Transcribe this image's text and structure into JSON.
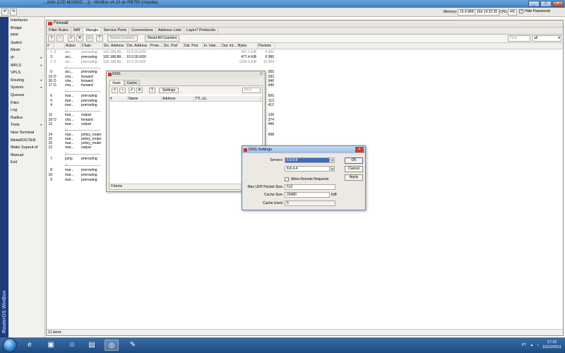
{
  "window": {
    "title": "... (Info (Lt'D MUNDO ...)) - WinBox v4.10 on RB750 (mipsbe)",
    "buttons": [
      "_",
      "□",
      "×"
    ]
  },
  "toolbar": {
    "undo": "↶",
    "redo": "↷",
    "memory_label": "Memory:",
    "memory_value": "15.4 MiB",
    "uptime_value": "16d 14:32:35",
    "cpu_label": "CPU:",
    "cpu_value": "4%",
    "hide_passwords_label": "Hide Passwords",
    "hide_passwords_checked": "✓"
  },
  "brand_vertical": "RouterOS WinBox",
  "sidebar": {
    "items": [
      {
        "label": "Interfaces",
        "arrow": ""
      },
      {
        "label": "Bridge",
        "arrow": ""
      },
      {
        "label": "PPP",
        "arrow": ""
      },
      {
        "label": "Switch",
        "arrow": ""
      },
      {
        "label": "Mesh",
        "arrow": ""
      },
      {
        "label": "IP",
        "arrow": "▸"
      },
      {
        "label": "MPLS",
        "arrow": "▸"
      },
      {
        "label": "VPLS",
        "arrow": ""
      },
      {
        "label": "Routing",
        "arrow": "▸"
      },
      {
        "label": "System",
        "arrow": "▸"
      },
      {
        "label": "Queues",
        "arrow": ""
      },
      {
        "label": "Files",
        "arrow": ""
      },
      {
        "label": "Log",
        "arrow": ""
      },
      {
        "label": "Radius",
        "arrow": ""
      },
      {
        "label": "Tools",
        "arrow": "▸"
      },
      {
        "label": "New Terminal",
        "arrow": ""
      },
      {
        "label": "MetaROUTER",
        "arrow": ""
      },
      {
        "label": "Make Supout.rif",
        "arrow": ""
      },
      {
        "label": "Manual",
        "arrow": ""
      },
      {
        "label": "Exit",
        "arrow": ""
      }
    ]
  },
  "firewall": {
    "title": "Firewall",
    "tabs": [
      "Filter Rules",
      "NAT",
      "Mangle",
      "Service Ports",
      "Connections",
      "Address Lists",
      "Layer7 Protocols"
    ],
    "active_tab": "Mangle",
    "toolbar": {
      "add": "+",
      "remove": "−",
      "enable": "✓",
      "disable": "✕",
      "comment": "▭",
      "filter": "⊤",
      "reset_counters": "Reset Counters",
      "reset_all_counters": "Reset All Counters",
      "find_placeholder": "Find",
      "select_value": "all",
      "select_arrow": "▾"
    },
    "columns": [
      "#",
      "",
      "Action",
      "Chain",
      "Src. Address",
      "Dst. Address",
      "Proto...",
      "Src. Port",
      "Dst. Port",
      "In. Inter...",
      "Out. Int...",
      "Bytes",
      "Packets"
    ],
    "rows": [
      {
        "num": "1",
        "flag": "X",
        "action": "acc...",
        "chain": "prerouting",
        "src": "192.168.88...",
        "dst": "10.0.10.0/30",
        "bytes": "407.1 KiB",
        "packets": "4 592",
        "kind": "disabled"
      },
      {
        "num": "3",
        "flag": "",
        "action": "acc...",
        "chain": "prerouting",
        "src": "192.168.88...",
        "dst": "10.0.30.0/30",
        "bytes": "477.4 KiB",
        "packets": "6 980",
        "kind": "normal"
      },
      {
        "num": "2",
        "flag": "X",
        "action": "acc...",
        "chain": "prerouting",
        "src": "192.168.88...",
        "dst": "10.0.20.0/30",
        "bytes": "1390.5 KiB",
        "packets": "15 909",
        "kind": "disabled"
      },
      {
        "num": "",
        "flag": "",
        "action": ":::",
        "chain": "",
        "src": "",
        "dst": "",
        "bytes": "",
        "packets": "",
        "kind": "comment"
      },
      {
        "num": "0",
        "flag": "",
        "action": "acc...",
        "chain": "prerouting",
        "src": "",
        "dst": "",
        "bytes": "",
        "packets": "055",
        "kind": "normal"
      },
      {
        "num": "19",
        "flag": "D",
        "action": "cha...",
        "chain": "forward",
        "src": "",
        "dst": "",
        "bytes": "",
        "packets": "293",
        "kind": "normal"
      },
      {
        "num": "20",
        "flag": "D",
        "action": "cha...",
        "chain": "forward",
        "src": "",
        "dst": "",
        "bytes": "",
        "packets": "946",
        "kind": "normal"
      },
      {
        "num": "17",
        "flag": "D",
        "action": "cha...",
        "chain": "forward",
        "src": "",
        "dst": "",
        "bytes": "",
        "packets": "640",
        "kind": "normal"
      },
      {
        "num": "",
        "flag": "",
        "action": ":::",
        "chain": "",
        "src": "",
        "dst": "",
        "bytes": "",
        "packets": "",
        "kind": "comment"
      },
      {
        "num": "6",
        "flag": "",
        "action": "mar...",
        "chain": "prerouting",
        "src": "",
        "dst": "",
        "bytes": "",
        "packets": "600",
        "kind": "normal"
      },
      {
        "num": "5",
        "flag": "",
        "action": "mar...",
        "chain": "prerouting",
        "src": "",
        "dst": "",
        "bytes": "",
        "packets": "113",
        "kind": "normal"
      },
      {
        "num": "4",
        "flag": "",
        "action": "mar...",
        "chain": "prerouting",
        "src": "",
        "dst": "",
        "bytes": "",
        "packets": "412",
        "kind": "normal"
      },
      {
        "num": "",
        "flag": "",
        "action": ":::",
        "chain": "",
        "src": "",
        "dst": "",
        "bytes": "",
        "packets": "",
        "kind": "comment"
      },
      {
        "num": "11",
        "flag": "",
        "action": "mar...",
        "chain": "output",
        "src": "",
        "dst": "",
        "bytes": "",
        "packets": "126",
        "kind": "normal"
      },
      {
        "num": "18",
        "flag": "D",
        "action": "cha...",
        "chain": "forward",
        "src": "",
        "dst": "",
        "bytes": "",
        "packets": "374",
        "kind": "normal"
      },
      {
        "num": "13",
        "flag": "",
        "action": "mar...",
        "chain": "output",
        "src": "",
        "dst": "",
        "bytes": "",
        "packets": "496",
        "kind": "normal"
      },
      {
        "num": "",
        "flag": "",
        "action": ":::",
        "chain": "",
        "src": "",
        "dst": "",
        "bytes": "",
        "packets": "",
        "kind": "comment"
      },
      {
        "num": "14",
        "flag": "",
        "action": "mar...",
        "chain": "policy_router",
        "src": "",
        "dst": "",
        "bytes": "",
        "packets": "998",
        "kind": "normal"
      },
      {
        "num": "15",
        "flag": "",
        "action": "mar...",
        "chain": "policy_router",
        "src": "",
        "dst": "",
        "bytes": "",
        "packets": "",
        "kind": "normal"
      },
      {
        "num": "16",
        "flag": "",
        "action": "mar...",
        "chain": "policy_router",
        "src": "",
        "dst": "",
        "bytes": "",
        "packets": "",
        "kind": "normal"
      },
      {
        "num": "12",
        "flag": "",
        "action": "mar...",
        "chain": "output",
        "src": "",
        "dst": "",
        "bytes": "",
        "packets": "",
        "kind": "normal"
      },
      {
        "num": "",
        "flag": "",
        "action": ":::",
        "chain": "",
        "src": "",
        "dst": "",
        "bytes": "",
        "packets": "",
        "kind": "comment"
      },
      {
        "num": "7",
        "flag": "",
        "action": "jump",
        "chain": "prerouting",
        "src": "",
        "dst": "",
        "bytes": "",
        "packets": "",
        "kind": "normal"
      },
      {
        "num": "",
        "flag": "",
        "action": ":::",
        "chain": "",
        "src": "",
        "dst": "",
        "bytes": "",
        "packets": "",
        "kind": "comment"
      },
      {
        "num": "8",
        "flag": "",
        "action": "mar...",
        "chain": "prerouting",
        "src": "",
        "dst": "",
        "bytes": "",
        "packets": "",
        "kind": "normal"
      },
      {
        "num": "10",
        "flag": "",
        "action": "mar...",
        "chain": "prerouting",
        "src": "",
        "dst": "",
        "bytes": "",
        "packets": "",
        "kind": "normal"
      },
      {
        "num": "9",
        "flag": "",
        "action": "mar...",
        "chain": "prerouting",
        "src": "",
        "dst": "",
        "bytes": "",
        "packets": "",
        "kind": "normal"
      }
    ],
    "status": "21 items"
  },
  "dns": {
    "title": "DNS",
    "close": "□",
    "tabs": [
      "Static",
      "Cache"
    ],
    "active_tab": "Static",
    "settings_button": "Settings",
    "find_placeholder": "Find",
    "columns": [
      "#",
      "Name",
      "Address",
      "TTL (s)"
    ],
    "status": "0 items"
  },
  "dns_settings": {
    "title": "DNS Settings",
    "close": "×",
    "servers_label": "Servers:",
    "server1": "8.8.8.8",
    "server2": "8.8.4.4",
    "allow_remote_label": "Allow Remote Requests",
    "max_udp_label": "Max UDP Packet Size:",
    "max_udp_value": "512",
    "cache_size_label": "Cache Size:",
    "cache_size_value": "20480",
    "cache_size_unit": "KiB",
    "cache_used_label": "Cache Used:",
    "cache_used_value": "5",
    "ok": "OK",
    "cancel": "Cancel",
    "apply": "Apply"
  },
  "taskbar": {
    "tray_lang": "PT",
    "time": "17:22",
    "date": "10/10/2011"
  },
  "colors": {
    "titlebar": "#4f8fd0",
    "taskbar": "#2a5a94",
    "accent_red": "#c33333",
    "brand_strip": "#1e3d7a"
  }
}
